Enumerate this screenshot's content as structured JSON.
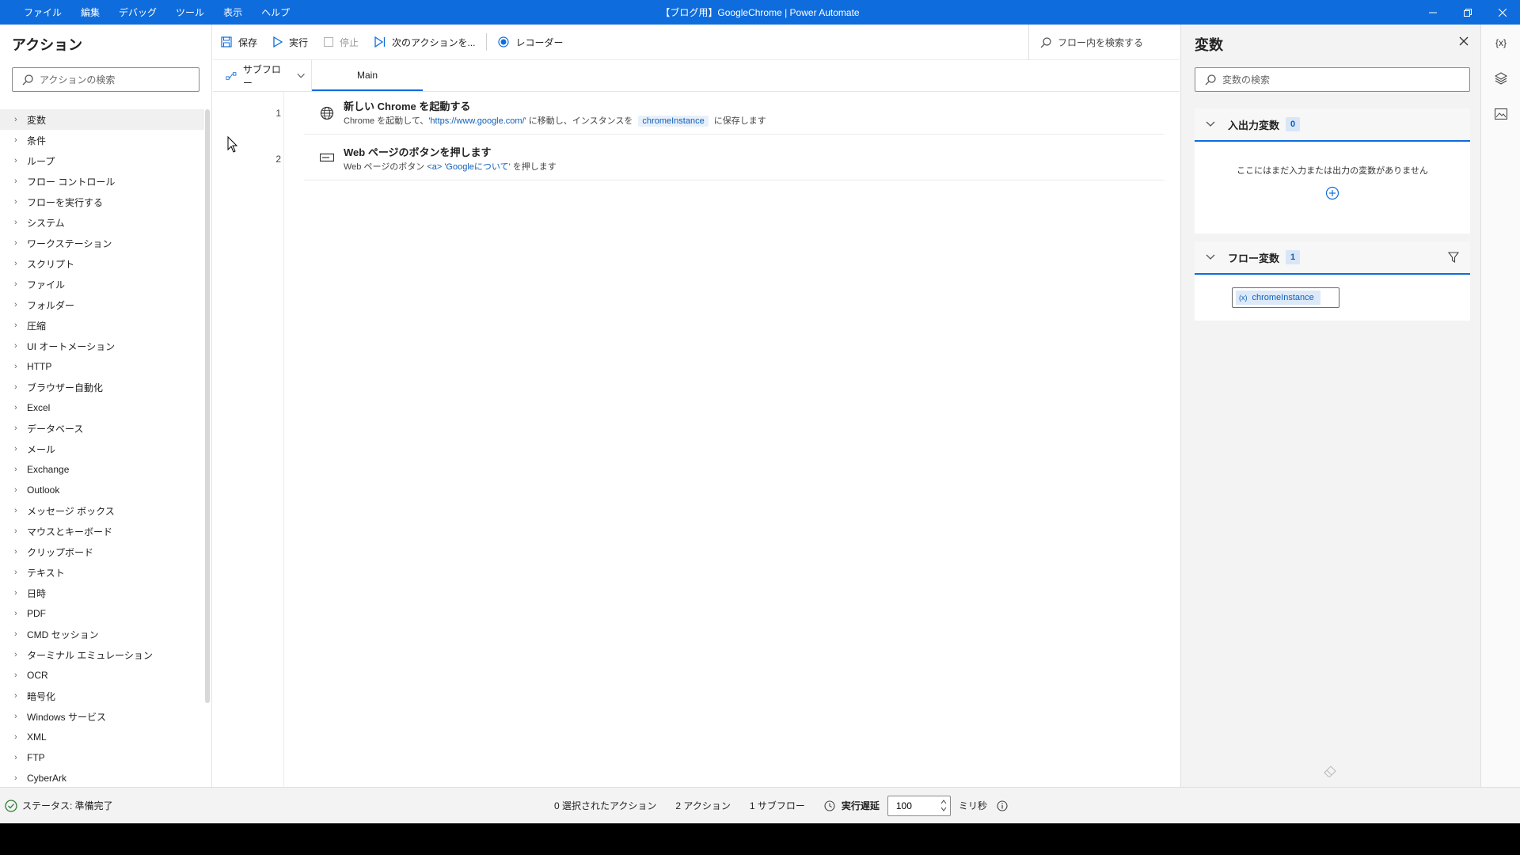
{
  "window": {
    "title": "【ブログ用】GoogleChrome | Power Automate",
    "menus": [
      "ファイル",
      "編集",
      "デバッグ",
      "ツール",
      "表示",
      "ヘルプ"
    ]
  },
  "actions_pane": {
    "title": "アクション",
    "search_placeholder": "アクションの検索",
    "categories": [
      "変数",
      "条件",
      "ループ",
      "フロー コントロール",
      "フローを実行する",
      "システム",
      "ワークステーション",
      "スクリプト",
      "ファイル",
      "フォルダー",
      "圧縮",
      "UI オートメーション",
      "HTTP",
      "ブラウザー自動化",
      "Excel",
      "データベース",
      "メール",
      "Exchange",
      "Outlook",
      "メッセージ ボックス",
      "マウスとキーボード",
      "クリップボード",
      "テキスト",
      "日時",
      "PDF",
      "CMD セッション",
      "ターミナル エミュレーション",
      "OCR",
      "暗号化",
      "Windows サービス",
      "XML",
      "FTP",
      "CyberArk"
    ]
  },
  "toolbar": {
    "save": "保存",
    "run": "実行",
    "stop": "停止",
    "next_action": "次のアクションを...",
    "recorder": "レコーダー",
    "flow_search": "フロー内を検索する"
  },
  "tabs": {
    "subflow": "サブフロー",
    "main": "Main"
  },
  "flow": {
    "actions": [
      {
        "num": "1",
        "icon": "globe-icon",
        "title": "新しい Chrome を起動する",
        "desc_pre": "Chrome を起動して、",
        "desc_str": "'https://www.google.com/'",
        "desc_mid": " に移動し、インスタンスを ",
        "desc_var": "chromeInstance",
        "desc_post": " に保存します"
      },
      {
        "num": "2",
        "icon": "button-icon",
        "title": "Web ページのボタンを押します",
        "desc_pre": "Web ページのボタン ",
        "desc_str": "<a> 'Googleについて'",
        "desc_post": " を押します"
      }
    ]
  },
  "variables_pane": {
    "title": "変数",
    "search_placeholder": "変数の検索",
    "io_section": {
      "label": "入出力変数",
      "count": "0",
      "empty_text": "ここにはまだ入力または出力の変数がありません"
    },
    "flow_section": {
      "label": "フロー変数",
      "count": "1",
      "variables": [
        "chromeInstance"
      ]
    }
  },
  "rail": {
    "vars_label": "{x}"
  },
  "statusbar": {
    "status": "ステータス: 準備完了",
    "selected": "0 選択されたアクション",
    "actions": "2 アクション",
    "subflows": "1 サブフロー",
    "delay_label": "実行遅延",
    "delay_value": "100",
    "unit": "ミリ秒"
  },
  "colors": {
    "accent": "#0f6cdc",
    "string_blue": "#0f5fb8",
    "status_green": "#2e7d32"
  }
}
